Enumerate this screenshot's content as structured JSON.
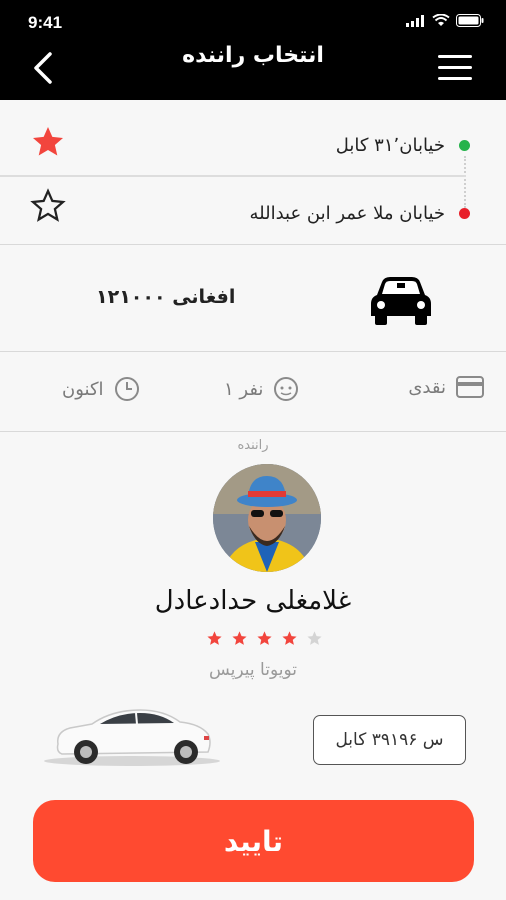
{
  "status_bar": {
    "time": "9:41"
  },
  "header": {
    "title": "انتخاب راننده"
  },
  "route": {
    "origin": "خیابان۳۱٬ کابل",
    "destination": "خیابان ملا عمر ابن عبدالله",
    "origin_dot_color": "#25b34b",
    "destination_dot_color": "#e8202a"
  },
  "fare": {
    "amount": "۱۲۱۰۰۰ افغانی"
  },
  "options": {
    "payment": "نقدی",
    "passengers": "۱ نفر",
    "time": "اکنون"
  },
  "driver": {
    "label": "راننده",
    "name": "غلامغلی حدادعادل",
    "rating": 4,
    "rating_max": 5,
    "car_model": "تویوتا پیرپس",
    "plate": "س ۳۹۱۹۶ کابل"
  },
  "confirm_button": {
    "label": "تایید"
  },
  "colors": {
    "accent": "#ff4a30",
    "star": "#f2453d",
    "star_empty": "#d4d4d4"
  }
}
